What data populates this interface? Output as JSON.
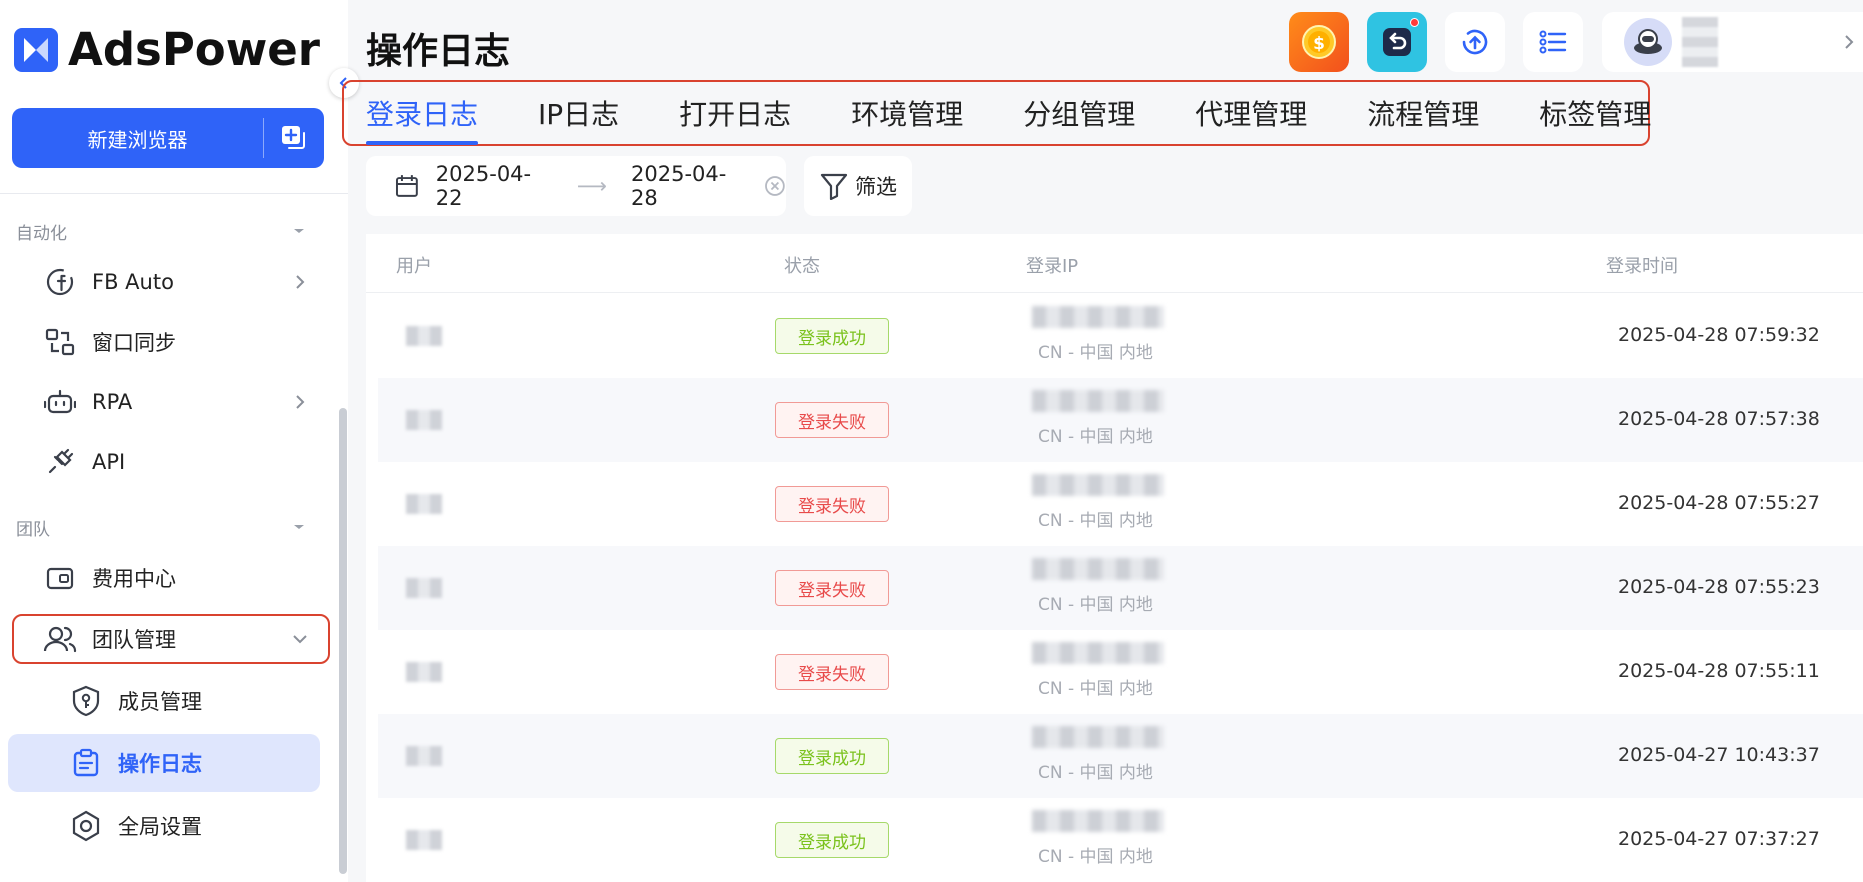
{
  "app": {
    "brand": "AdsPower",
    "page_title": "操作日志",
    "accent": "#2f63f8",
    "highlight": "#d9432f"
  },
  "sidebar": {
    "new_browser_label": "新建浏览器",
    "sections": [
      {
        "label": "自动化"
      },
      {
        "label": "团队"
      }
    ],
    "items": [
      {
        "label": "FB Auto",
        "icon": "fb-auto-icon"
      },
      {
        "label": "窗口同步",
        "icon": "window-sync-icon"
      },
      {
        "label": "RPA",
        "icon": "robot-icon"
      },
      {
        "label": "API",
        "icon": "plug-icon"
      },
      {
        "label": "费用中心",
        "icon": "wallet-icon"
      },
      {
        "label": "团队管理",
        "icon": "team-icon"
      }
    ],
    "sub_items": [
      {
        "label": "成员管理",
        "icon": "shield-key-icon"
      },
      {
        "label": "操作日志",
        "icon": "clipboard-icon",
        "active": true
      },
      {
        "label": "全局设置",
        "icon": "hex-gear-icon"
      }
    ]
  },
  "tabs": [
    {
      "label": "登录日志",
      "active": true
    },
    {
      "label": "IP日志"
    },
    {
      "label": "打开日志"
    },
    {
      "label": "环境管理"
    },
    {
      "label": "分组管理"
    },
    {
      "label": "代理管理"
    },
    {
      "label": "流程管理"
    },
    {
      "label": "标签管理"
    }
  ],
  "filters": {
    "start_date": "2025-04-22",
    "end_date": "2025-04-28",
    "filter_label": "筛选"
  },
  "table": {
    "columns": [
      "用户",
      "状态",
      "登录IP",
      "登录时间"
    ],
    "rows": [
      {
        "status": "登录成功",
        "ok": true,
        "location": "CN - 中国 内地",
        "time": "2025-04-28 07:59:32"
      },
      {
        "status": "登录失败",
        "ok": false,
        "location": "CN - 中国 内地",
        "time": "2025-04-28 07:57:38"
      },
      {
        "status": "登录失败",
        "ok": false,
        "location": "CN - 中国 内地",
        "time": "2025-04-28 07:55:27"
      },
      {
        "status": "登录失败",
        "ok": false,
        "location": "CN - 中国 内地",
        "time": "2025-04-28 07:55:23"
      },
      {
        "status": "登录失败",
        "ok": false,
        "location": "CN - 中国 内地",
        "time": "2025-04-28 07:55:11"
      },
      {
        "status": "登录成功",
        "ok": true,
        "location": "CN - 中国 内地",
        "time": "2025-04-27 10:43:37"
      },
      {
        "status": "登录成功",
        "ok": true,
        "location": "CN - 中国 内地",
        "time": "2025-04-27 07:37:27"
      }
    ]
  }
}
